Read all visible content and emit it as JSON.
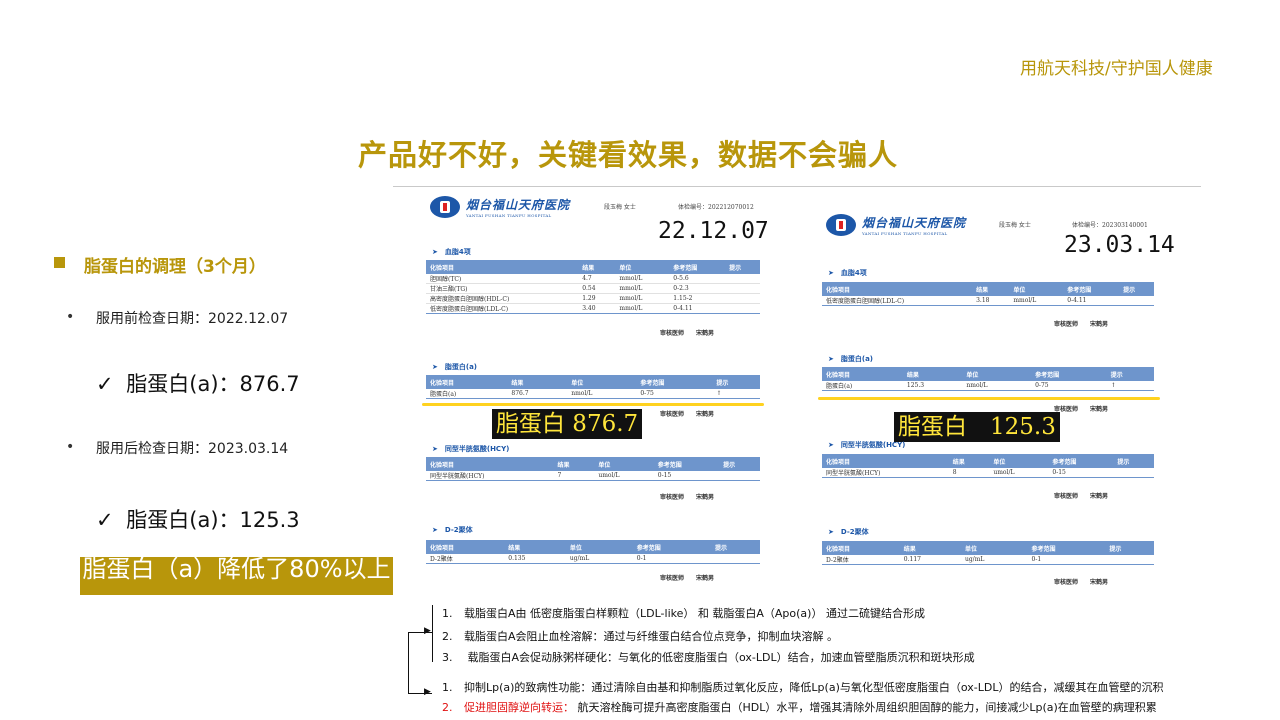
{
  "brand": "用航天科技/守护国人健康",
  "title": "产品好不好，关键看效果，数据不会骗人",
  "left": {
    "section_heading": "脂蛋白的调理（3个月）",
    "before_label": "服用前检查日期：2022.12.07",
    "before_value": "脂蛋白(a)：876.7",
    "after_label": "服用后检查日期：2023.03.14",
    "after_value": "脂蛋白(a)：125.3",
    "check_mark": "✓",
    "bullet_dot": "•",
    "banner": "脂蛋白（a）降低了80%以上"
  },
  "reports": [
    {
      "hospital_cn": "烟台福山天府医院",
      "hospital_en": "YANTAI FUSHAN TIANFU HOSPITAL",
      "patient": "段玉梅 女士",
      "exam_no": "体检编号：202212070012",
      "date": "22.12.07",
      "headers": [
        "化验项目",
        "结果",
        "单位",
        "参考范围",
        "提示"
      ],
      "sections": [
        {
          "title": "血脂4项",
          "rows": [
            [
              "胆固醇(TC)",
              "4.7",
              "mmol/L",
              "0-5.6",
              ""
            ],
            [
              "甘油三酯(TG)",
              "0.54",
              "mmol/L",
              "0-2.3",
              ""
            ],
            [
              "高密度脂蛋白胆固醇(HDL-C)",
              "1.29",
              "mmol/L",
              "1.15-2",
              ""
            ],
            [
              "低密度脂蛋白胆固醇(LDL-C)",
              "3.40",
              "mmol/L",
              "0-4.11",
              ""
            ]
          ]
        },
        {
          "title": "脂蛋白(a)",
          "rows": [
            [
              "脂蛋白(a)",
              "876.7",
              "nmol/L",
              "0-75",
              "↑"
            ]
          ]
        },
        {
          "title": "同型半胱氨酸(HCY)",
          "rows": [
            [
              "同型半胱氨酸(HCY)",
              "7",
              "umol/L",
              "0-15",
              ""
            ]
          ]
        },
        {
          "title": "D-2聚体",
          "rows": [
            [
              "D-2聚体",
              "0.135",
              "ug/mL",
              "0-1",
              ""
            ]
          ]
        }
      ],
      "sign": "审核医师　　宋鹤男",
      "callout": "脂蛋白 876.7"
    },
    {
      "hospital_cn": "烟台福山天府医院",
      "hospital_en": "YANTAI FUSHAN TIANFU HOSPITAL",
      "patient": "段玉梅 女士",
      "exam_no": "体检编号：202303140001",
      "date": "23.03.14",
      "headers": [
        "化验项目",
        "结果",
        "单位",
        "参考范围",
        "提示"
      ],
      "sections": [
        {
          "title": "血脂4项",
          "rows": [
            [
              "低密度脂蛋白胆固醇(LDL-C)",
              "3.18",
              "mmol/L",
              "0-4.11",
              ""
            ]
          ]
        },
        {
          "title": "脂蛋白(a)",
          "rows": [
            [
              "脂蛋白(a)",
              "125.3",
              "nmol/L",
              "0-75",
              "↑"
            ]
          ]
        },
        {
          "title": "同型半胱氨酸(HCY)",
          "rows": [
            [
              "同型半胱氨酸(HCY)",
              "8",
              "umol/L",
              "0-15",
              ""
            ]
          ]
        },
        {
          "title": "D-2聚体",
          "rows": [
            [
              "D-2聚体",
              "0.117",
              "ug/mL",
              "0-1",
              ""
            ]
          ]
        }
      ],
      "sign": "审核医师　　宋鹤男",
      "callout": "脂蛋白　125.3"
    }
  ],
  "notes": [
    {
      "num": "1.",
      "text": "载脂蛋白A由 低密度脂蛋白样颗粒（LDL-like） 和 载脂蛋白A（Apo(a)） 通过二硫键结合形成"
    },
    {
      "num": "2.",
      "text": "载脂蛋白A会阻止血栓溶解：通过与纤维蛋白结合位点竞争，抑制血块溶解 。"
    },
    {
      "num": "3.",
      "text": " 载脂蛋白A会促动脉粥样硬化：与氧化的低密度脂蛋白（ox-LDL）结合，加速血管壁脂质沉积和斑块形成"
    },
    {
      "num": "1.",
      "text": "抑制Lp(a)的致病性功能：通过清除自由基和抑制脂质过氧化反应，降低Lp(a)与氧化型低密度脂蛋白（ox-LDL）的结合，减缓其在血管壁的沉积"
    },
    {
      "num": "2.",
      "red_label": "促进胆固醇逆向转运：",
      "text": " 航天溶栓酶可提升高密度脂蛋白（HDL）水平，增强其清除外周组织胆固醇的能力，间接减少Lp(a)在血管壁的病理积累"
    }
  ]
}
